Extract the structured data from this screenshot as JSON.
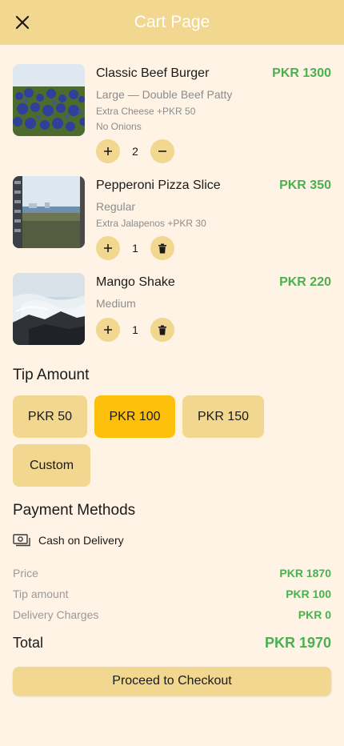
{
  "app_bar": {
    "title": "Cart Page",
    "close_icon": "close-icon"
  },
  "items": [
    {
      "name": "Classic Beef Burger",
      "price": "PKR 1300",
      "variant": "Large — Double Beef Patty",
      "addons": [
        "Extra Cheese +PKR 50",
        "No Onions"
      ],
      "quantity": "2",
      "decrement_icon": "minus-icon"
    },
    {
      "name": "Pepperoni Pizza Slice",
      "price": "PKR 350",
      "variant": "Regular",
      "addons": [
        "Extra Jalapenos +PKR 30"
      ],
      "quantity": "1",
      "decrement_icon": "trash-icon"
    },
    {
      "name": "Mango Shake",
      "price": "PKR 220",
      "variant": "Medium",
      "addons": [],
      "quantity": "1",
      "decrement_icon": "trash-icon"
    }
  ],
  "tip": {
    "title": "Tip Amount",
    "options": [
      "PKR 50",
      "PKR 100",
      "PKR 150",
      "Custom"
    ],
    "selected": "PKR 100"
  },
  "payment": {
    "title": "Payment Methods",
    "method": "Cash on Delivery",
    "icon": "cash-icon"
  },
  "summary": {
    "price_label": "Price",
    "price_value": "PKR 1870",
    "tip_label": "Tip amount",
    "tip_value": "PKR 100",
    "delivery_label": "Delivery Charges",
    "delivery_value": "PKR 0",
    "total_label": "Total",
    "total_value": "PKR 1970"
  },
  "checkout_label": "Proceed to Checkout",
  "colors": {
    "background": "#FEF3E4",
    "primary": "#F1D78F",
    "selected": "#FCC00C",
    "price_green": "#4CAF50"
  }
}
